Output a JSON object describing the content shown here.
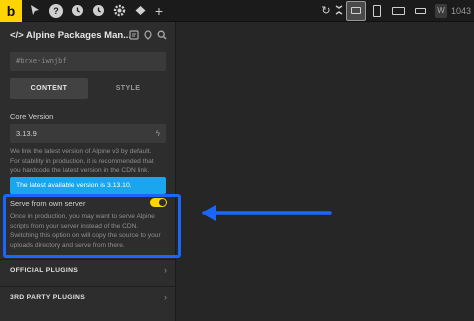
{
  "topbar": {
    "logo": "b",
    "icons": [
      "cursor-icon",
      "help-icon",
      "history-icon",
      "settings-icon",
      "add-icon"
    ],
    "right_icons": [
      "refresh-icon",
      "expand-icon"
    ],
    "devices": [
      "desktop-icon",
      "tablet-icon",
      "tablet-landscape-icon",
      "mobile-landscape-icon",
      "mobile-icon"
    ],
    "width_label": "W",
    "width_value": "1043"
  },
  "panel": {
    "title": "</> Alpine Packages Man...",
    "header_icons": [
      "bookmark-icon",
      "pin-icon",
      "search-icon"
    ],
    "id_value": "#brxe-iwnjbf",
    "tabs": [
      "CONTENT",
      "STYLE"
    ],
    "core_version_label": "Core Version",
    "core_version_value": "3.13.9",
    "core_desc_1": "We link the latest version of Alpine v3 by default.",
    "core_desc_2": "For stability in production, it is recommended that",
    "core_desc_3": "you hardcode the latest version in the CDN link.",
    "latest_notice": "The latest available version is 3.13.10.",
    "serve_label": "Serve from own server",
    "serve_enabled": true,
    "serve_desc_1": "Once in production, you may want to serve Alpine",
    "serve_desc_2": "scripts from your server instead of the CDN.",
    "serve_desc_3": "Switching this option on will copy the source to your",
    "serve_desc_4": "uploads directory and serve from there.",
    "official_plugins": "OFFICIAL PLUGINS",
    "third_party_plugins": "3RD PARTY PLUGINS"
  },
  "colors": {
    "accent": "#ffd400",
    "info": "#1aa6ec",
    "highlight": "#1a66ff"
  }
}
